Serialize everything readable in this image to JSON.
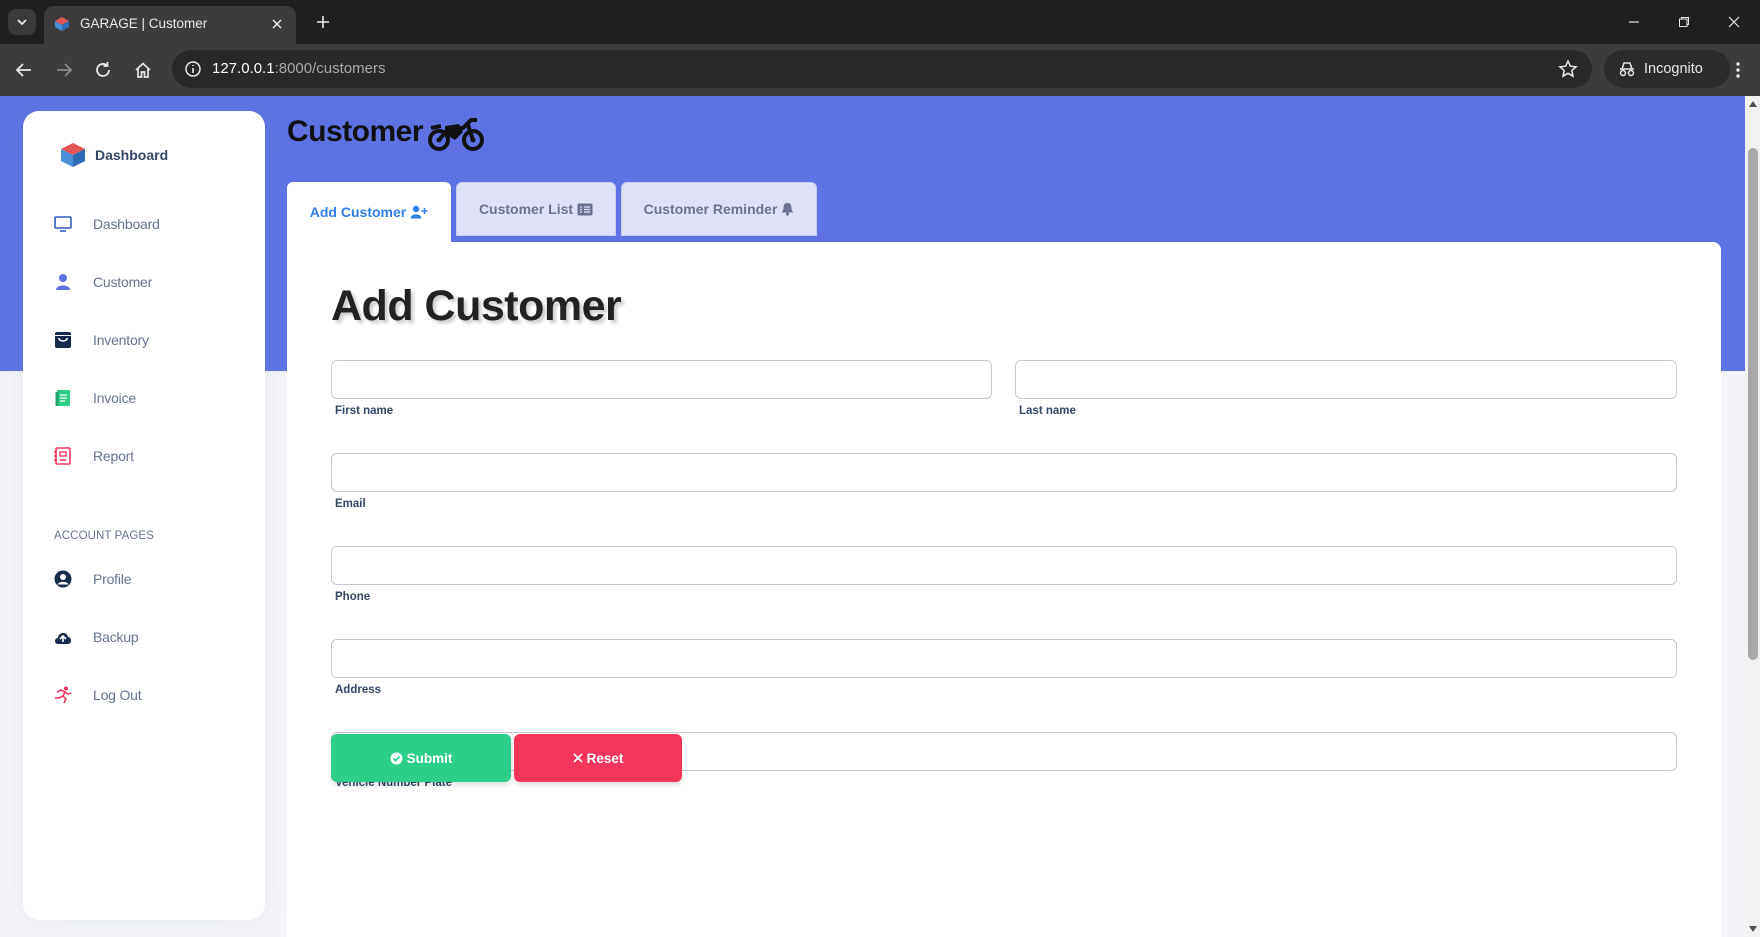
{
  "browser": {
    "tab_title": "GARAGE | Customer",
    "url_host": "127.0.0.1",
    "url_rest": ":8000/customers",
    "incognito_label": "Incognito"
  },
  "sidebar": {
    "brand": "Dashboard",
    "items": [
      {
        "label": "Dashboard",
        "icon": "monitor-icon"
      },
      {
        "label": "Customer",
        "icon": "user-icon"
      },
      {
        "label": "Inventory",
        "icon": "bag-icon"
      },
      {
        "label": "Invoice",
        "icon": "document-icon"
      },
      {
        "label": "Report",
        "icon": "report-icon"
      }
    ],
    "section_heading": "ACCOUNT PAGES",
    "account_items": [
      {
        "label": "Profile",
        "icon": "profile-icon"
      },
      {
        "label": "Backup",
        "icon": "cloud-upload-icon"
      },
      {
        "label": "Log Out",
        "icon": "running-icon"
      }
    ]
  },
  "page": {
    "title": "Customer",
    "tabs": [
      {
        "label": "Add Customer",
        "active": true
      },
      {
        "label": "Customer List",
        "active": false
      },
      {
        "label": "Customer Reminder",
        "active": false
      }
    ]
  },
  "form": {
    "heading": "Add Customer",
    "fields": {
      "first_name": {
        "label": "First name",
        "value": ""
      },
      "last_name": {
        "label": "Last name",
        "value": ""
      },
      "email": {
        "label": "Email",
        "value": ""
      },
      "phone": {
        "label": "Phone",
        "value": ""
      },
      "address": {
        "label": "Address",
        "value": ""
      },
      "vehicle_plate": {
        "label": "Vehicle Number Plate",
        "value": ""
      }
    },
    "submit_label": "Submit",
    "reset_label": "Reset"
  },
  "colors": {
    "hero": "#5e72e4",
    "submit": "#2dce89",
    "reset": "#f5365c",
    "active_tab_text": "#2f80ed"
  }
}
